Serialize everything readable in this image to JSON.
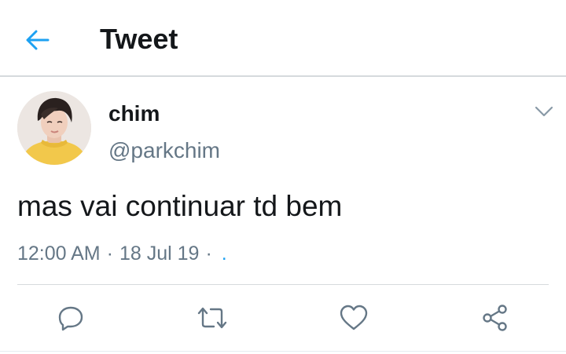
{
  "header": {
    "title": "Tweet",
    "back_icon": "arrow-left-icon",
    "accent_color": "#1da1f2"
  },
  "tweet": {
    "display_name": "chim",
    "handle": "@parkchim",
    "text": "mas vai continuar td bem",
    "time": "12:00 AM",
    "date": "18 Jul 19",
    "source": ".",
    "separator": "·",
    "avatar_icon": "profile-avatar-image",
    "menu_icon": "chevron-down-icon"
  },
  "actions": [
    {
      "name": "reply",
      "icon": "reply-icon"
    },
    {
      "name": "retweet",
      "icon": "retweet-icon"
    },
    {
      "name": "like",
      "icon": "heart-icon"
    },
    {
      "name": "share",
      "icon": "share-icon"
    }
  ],
  "colors": {
    "text_primary": "#14171a",
    "text_secondary": "#657786",
    "divider": "#d6dadd",
    "link": "#1da1f2"
  }
}
